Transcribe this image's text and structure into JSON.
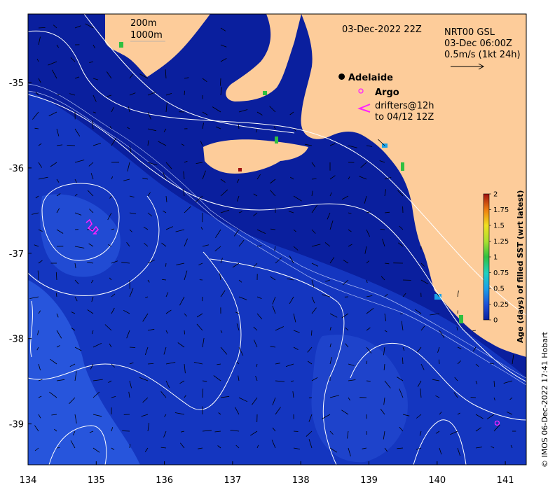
{
  "map": {
    "lon_range": [
      134,
      141.3
    ],
    "lat_range": [
      -39.5,
      -34.2
    ],
    "lon_ticks": [
      {
        "value": 134,
        "label": "134"
      },
      {
        "value": 135,
        "label": "135"
      },
      {
        "value": 136,
        "label": "136"
      },
      {
        "value": 137,
        "label": "137"
      },
      {
        "value": 138,
        "label": "138"
      },
      {
        "value": 139,
        "label": "139"
      },
      {
        "value": 140,
        "label": "140"
      },
      {
        "value": 141,
        "label": "141"
      }
    ],
    "lat_ticks": [
      {
        "value": -35,
        "label": "-35"
      },
      {
        "value": -36,
        "label": "-36"
      },
      {
        "value": -37,
        "label": "-37"
      },
      {
        "value": -38,
        "label": "-38"
      },
      {
        "value": -39,
        "label": "-39"
      }
    ],
    "colors": {
      "land": "#fdcc9a",
      "ocean_deep": "#0a1f9e",
      "ocean_mid": "#1436c0",
      "ocean_light": "#2a5ae0",
      "contour": "#ffffff",
      "argo": "#ff22ff",
      "drifter": "#ff22ff"
    }
  },
  "annotations": {
    "depth_200": "200m",
    "depth_1000": "1000m",
    "date": "03-Dec-2022 22Z",
    "source_line1": "NRT00 GSL",
    "source_line2": "03-Dec 06:00Z",
    "source_line3": "0.5m/s (1kt 24h)",
    "city": "Adelaide",
    "argo_label": "Argo",
    "drifter_line1": "drifters@12h",
    "drifter_line2": "to 04/12 12Z",
    "credit": "© IMOS 06-Dec-2022 17:41 Hobart"
  },
  "colorbar": {
    "title": "Age (days) of filled SST (wrt latest)",
    "ticks": [
      {
        "value": 0,
        "label": "0"
      },
      {
        "value": 0.25,
        "label": "0.25"
      },
      {
        "value": 0.5,
        "label": "0.5"
      },
      {
        "value": 0.75,
        "label": "0.75"
      },
      {
        "value": 1,
        "label": "1"
      },
      {
        "value": 1.25,
        "label": "1.25"
      },
      {
        "value": 1.5,
        "label": "1.5"
      },
      {
        "value": 1.75,
        "label": "1.75"
      },
      {
        "value": 2,
        "label": "2"
      }
    ],
    "range": [
      0,
      2
    ]
  },
  "points": {
    "adelaide": {
      "lon": 138.6,
      "lat": -34.93
    },
    "argo": {
      "lon": 140.88,
      "lat": -38.99
    }
  }
}
